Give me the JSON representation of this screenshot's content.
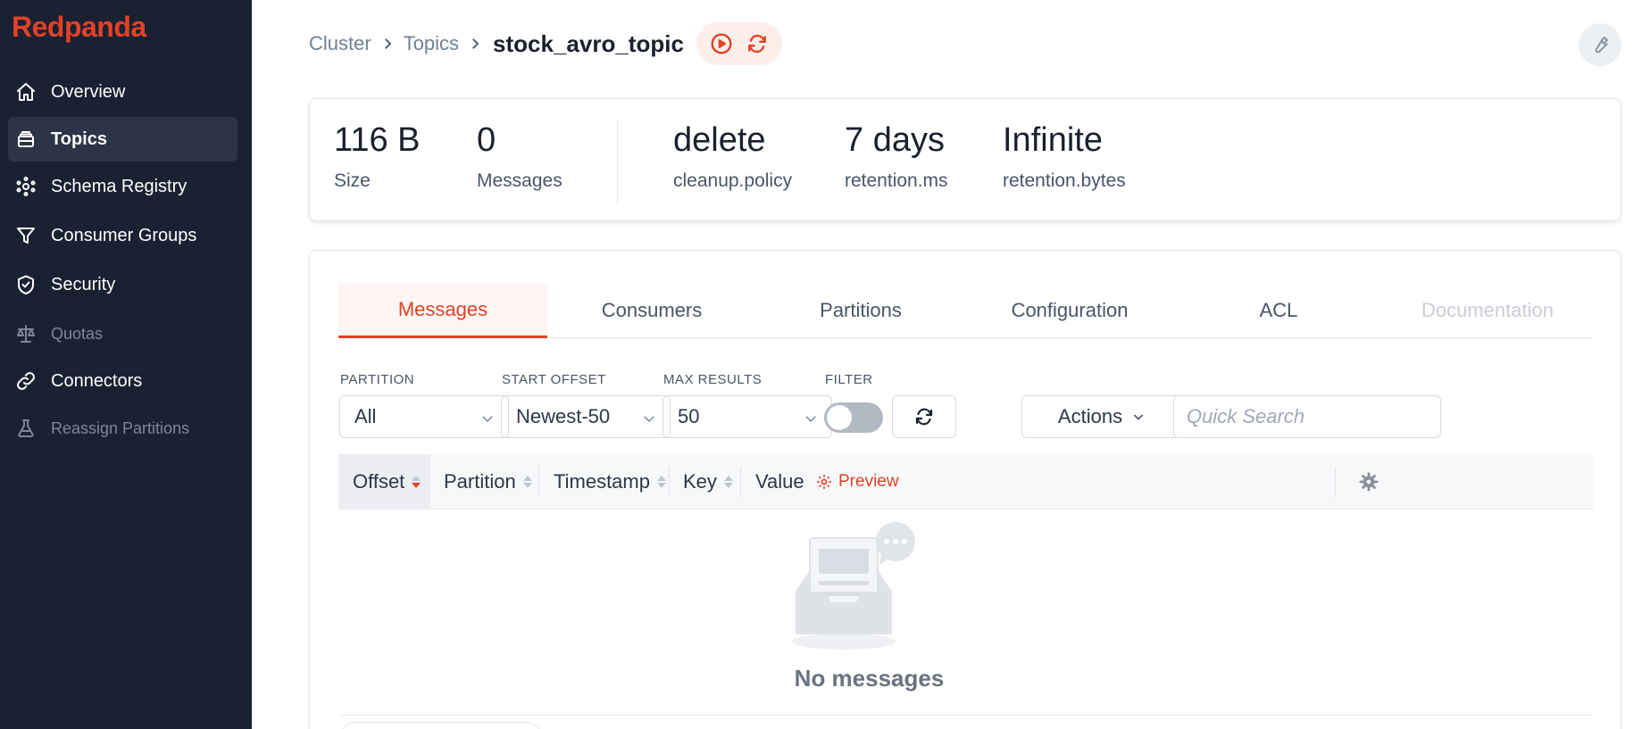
{
  "sidebar": {
    "logo": "Redpanda",
    "items": [
      {
        "label": "Overview",
        "icon": "home-icon"
      },
      {
        "label": "Topics",
        "icon": "layers-icon",
        "active": true
      },
      {
        "label": "Schema Registry",
        "icon": "schema-icon"
      },
      {
        "label": "Consumer Groups",
        "icon": "funnel-icon"
      },
      {
        "label": "Security",
        "icon": "shield-icon"
      },
      {
        "label": "Quotas",
        "icon": "scale-icon",
        "disabled": true
      },
      {
        "label": "Connectors",
        "icon": "link-icon"
      },
      {
        "label": "Reassign Partitions",
        "icon": "beaker-icon",
        "disabled": true
      }
    ]
  },
  "breadcrumb": {
    "items": [
      "Cluster",
      "Topics"
    ],
    "current": "stock_avro_topic"
  },
  "stats": [
    {
      "value": "116 B",
      "label": "Size"
    },
    {
      "value": "0",
      "label": "Messages"
    },
    {
      "value": "delete",
      "label": "cleanup.policy"
    },
    {
      "value": "7 days",
      "label": "retention.ms"
    },
    {
      "value": "Infinite",
      "label": "retention.bytes"
    }
  ],
  "tabs": [
    {
      "label": "Messages",
      "active": true
    },
    {
      "label": "Consumers"
    },
    {
      "label": "Partitions"
    },
    {
      "label": "Configuration"
    },
    {
      "label": "ACL"
    },
    {
      "label": "Documentation",
      "disabled": true
    }
  ],
  "filters": {
    "partition": {
      "label": "PARTITION",
      "value": "All"
    },
    "start_offset": {
      "label": "START OFFSET",
      "value": "Newest-50"
    },
    "max_results": {
      "label": "MAX RESULTS",
      "value": "50"
    },
    "filter": {
      "label": "FILTER",
      "enabled": false
    },
    "actions_label": "Actions",
    "search_placeholder": "Quick Search"
  },
  "table": {
    "columns": [
      "Offset",
      "Partition",
      "Timestamp",
      "Key",
      "Value"
    ],
    "preview_label": "Preview"
  },
  "empty_state": {
    "text": "No messages"
  },
  "colors": {
    "accent": "#e14226",
    "sidebar_bg": "#1a2133"
  }
}
